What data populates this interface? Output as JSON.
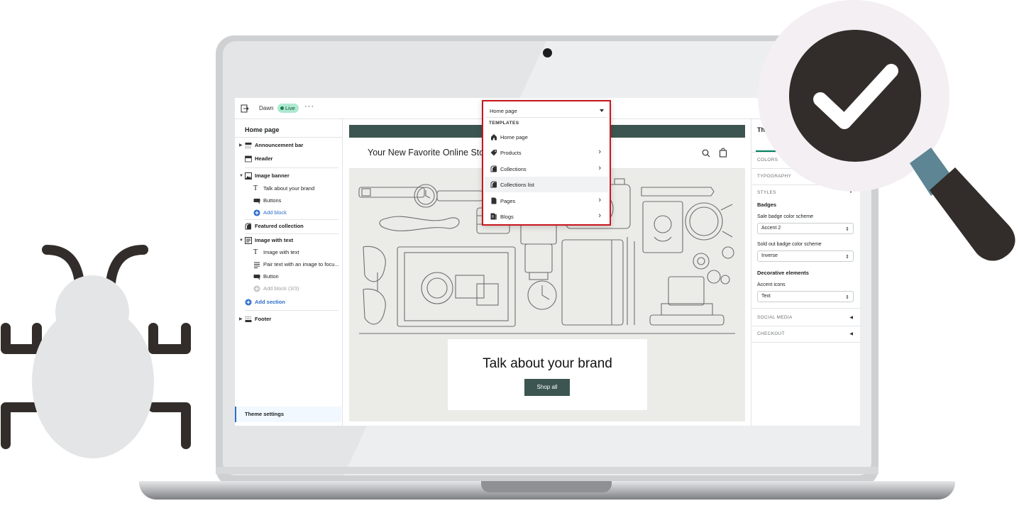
{
  "app": {
    "theme_name": "Dawn",
    "live_label": "Live",
    "more_label": "···",
    "template_select": "Home page"
  },
  "sidebar": {
    "title": "Home page",
    "items": [
      {
        "label": "Announcement bar",
        "kind": "section",
        "icon": "announcement-icon"
      },
      {
        "label": "Header",
        "kind": "section",
        "icon": "header-icon"
      },
      {
        "label": "Image banner",
        "kind": "section",
        "icon": "image-icon"
      },
      {
        "label": "Talk about your brand",
        "kind": "block",
        "icon": "text-icon"
      },
      {
        "label": "Buttons",
        "kind": "block",
        "icon": "button-icon"
      },
      {
        "label": "Add block",
        "kind": "link",
        "icon": "plus-circle-icon"
      },
      {
        "label": "Featured collection",
        "kind": "section",
        "icon": "collection-icon"
      },
      {
        "label": "Image with text",
        "kind": "section",
        "icon": "image-text-icon"
      },
      {
        "label": "Image with text",
        "kind": "block",
        "icon": "text-icon"
      },
      {
        "label": "Pair text with an image to focu...",
        "kind": "block",
        "icon": "paragraph-icon"
      },
      {
        "label": "Button",
        "kind": "block",
        "icon": "button-icon"
      },
      {
        "label": "Add block (3/3)",
        "kind": "muted",
        "icon": "plus-circle-icon"
      },
      {
        "label": "Add section",
        "kind": "link",
        "icon": "plus-circle-icon"
      },
      {
        "label": "Footer",
        "kind": "section",
        "icon": "footer-icon"
      }
    ],
    "footer_label": "Theme settings"
  },
  "dropdown": {
    "selected": "Home page",
    "heading": "TEMPLATES",
    "items": [
      {
        "label": "Home page",
        "icon": "home-icon",
        "has_arrow": false
      },
      {
        "label": "Products",
        "icon": "tag-icon",
        "has_arrow": true
      },
      {
        "label": "Collections",
        "icon": "collection-icon",
        "has_arrow": true
      },
      {
        "label": "Collections list",
        "icon": "collection-icon",
        "has_arrow": false
      },
      {
        "label": "Pages",
        "icon": "page-icon",
        "has_arrow": true
      },
      {
        "label": "Blogs",
        "icon": "blog-icon",
        "has_arrow": true
      }
    ]
  },
  "preview": {
    "store_title": "Your New Favorite Online Store",
    "brand_heading": "Talk about your brand",
    "shop_button": "Shop all"
  },
  "right_panel": {
    "title": "Theme settings",
    "colors_head": "COLORS",
    "typography_head": "TYPOGRAPHY",
    "styles_head": "STYLES",
    "badges_sub": "Badges",
    "sale_label": "Sale badge color scheme",
    "sale_value": "Accent 2",
    "soldout_label": "Sold out badge color scheme",
    "soldout_value": "Inverse",
    "decor_sub": "Decorative elements",
    "accent_label": "Accent icons",
    "accent_value": "Text",
    "social_head": "SOCIAL MEDIA",
    "checkout_head": "CHECKOUT"
  },
  "colors": {
    "accent": "#3d5550",
    "live_badge": "#aee9d1",
    "highlight_border": "#c8161d",
    "check_badge": "#322d2a",
    "bug": "#e4e5e6",
    "bug_legs": "#322d2a"
  }
}
